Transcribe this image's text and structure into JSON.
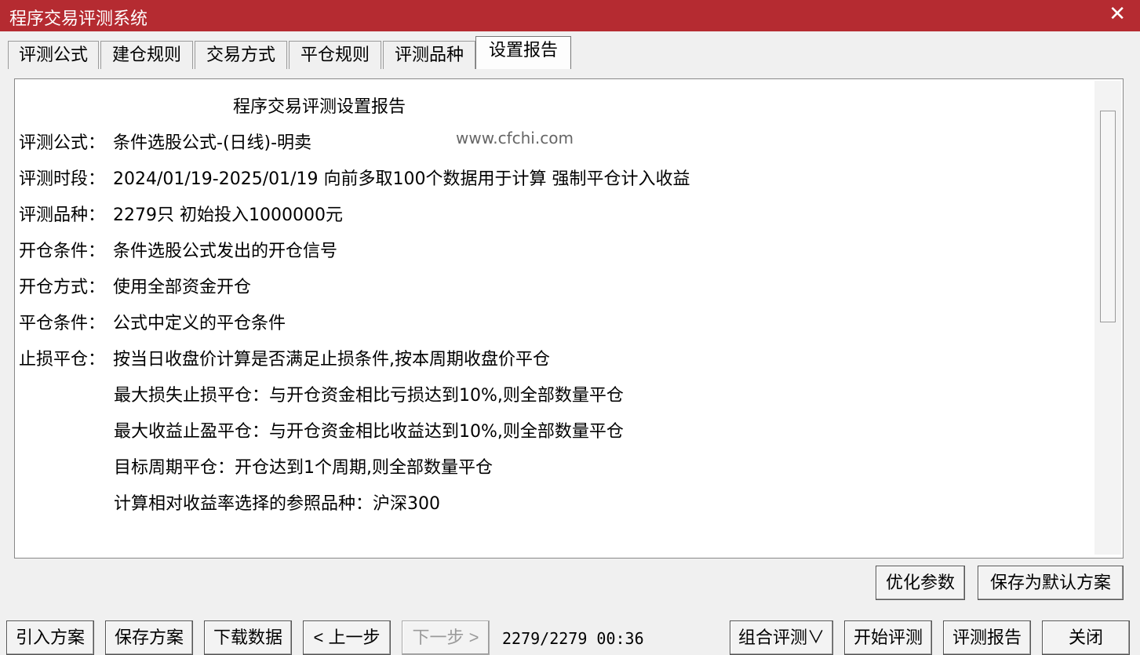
{
  "window": {
    "title": "程序交易评测系统",
    "close_glyph": "✕"
  },
  "tabs": [
    {
      "label": "评测公式"
    },
    {
      "label": "建仓规则"
    },
    {
      "label": "交易方式"
    },
    {
      "label": "平仓规则"
    },
    {
      "label": "评测品种"
    },
    {
      "label": "设置报告",
      "active": true
    }
  ],
  "report": {
    "title": "程序交易评测设置报告",
    "watermark": "www.cfchi.com",
    "rows": [
      {
        "label": "评测公式：",
        "value": "条件选股公式-(日线)-明卖"
      },
      {
        "label": "评测时段：",
        "value": "2024/01/19-2025/01/19 向前多取100个数据用于计算 强制平仓计入收益"
      },
      {
        "label": "评测品种：",
        "value": "2279只 初始投入1000000元"
      },
      {
        "label": "开仓条件：",
        "value": "条件选股公式发出的开仓信号"
      },
      {
        "label": "开仓方式：",
        "value": "使用全部资金开仓"
      },
      {
        "label": "平仓条件：",
        "value": "公式中定义的平仓条件"
      },
      {
        "label": "止损平仓：",
        "value": "按当日收盘价计算是否满足止损条件,按本周期收盘价平仓"
      }
    ],
    "sub_rows": [
      "最大损失止损平仓：与开仓资金相比亏损达到10%,则全部数量平仓",
      "最大收益止盈平仓：与开仓资金相比收益达到10%,则全部数量平仓",
      "目标周期平仓：开仓达到1个周期,则全部数量平仓",
      "计算相对收益率选择的参照品种：沪深300"
    ]
  },
  "actions": {
    "optimize": "优化参数",
    "save_default": "保存为默认方案"
  },
  "footer": {
    "import": "引入方案",
    "save": "保存方案",
    "download": "下载数据",
    "prev": "< 上一步",
    "next": "下一步 >",
    "status": "2279/2279 00:36",
    "combo": "组合评测∨",
    "start": "开始评测",
    "report": "评测报告",
    "close": "关闭"
  }
}
